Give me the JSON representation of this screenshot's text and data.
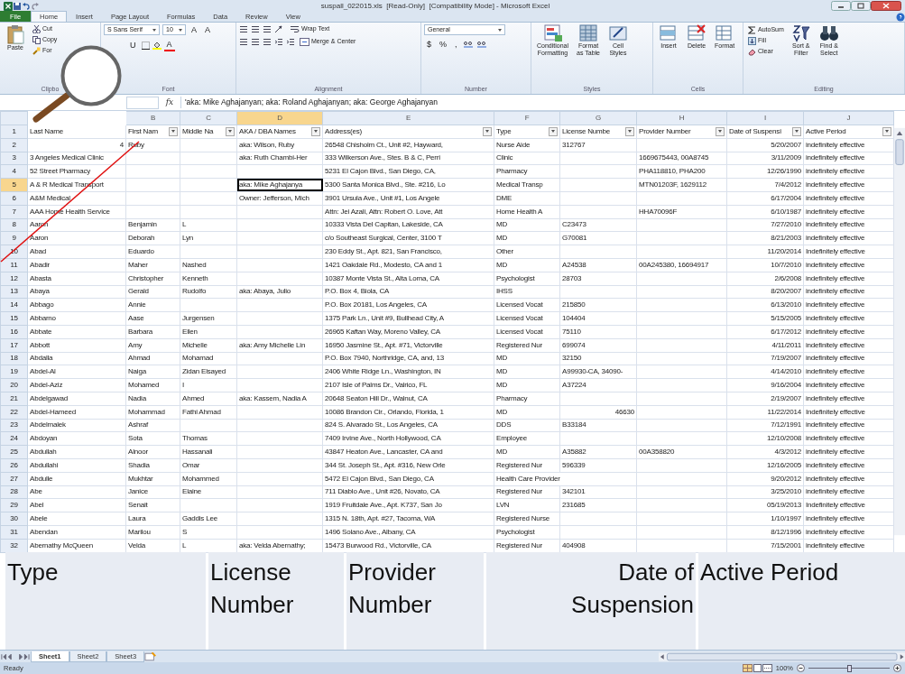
{
  "window": {
    "title": "suspall_022015.xls  [Read-Only]  [Compatibility Mode] - Microsoft Excel"
  },
  "ribbon_tabs": [
    {
      "label": "File",
      "kind": "file",
      "selected": false
    },
    {
      "label": "Home",
      "kind": "tab",
      "selected": true
    },
    {
      "label": "Insert",
      "kind": "tab",
      "selected": false
    },
    {
      "label": "Page Layout",
      "kind": "tab",
      "selected": false
    },
    {
      "label": "Formulas",
      "kind": "tab",
      "selected": false
    },
    {
      "label": "Data",
      "kind": "tab",
      "selected": false
    },
    {
      "label": "Review",
      "kind": "tab",
      "selected": false
    },
    {
      "label": "View",
      "kind": "tab",
      "selected": false
    }
  ],
  "ribbon_groups": [
    {
      "label": "Clipbo",
      "controls": [
        {
          "kind": "large",
          "lines": [
            "Paste"
          ]
        },
        {
          "kind": "stack",
          "items": [
            "Cut",
            "Copy",
            "For"
          ]
        }
      ]
    },
    {
      "label": "Font",
      "controls": [
        {
          "kind": "field",
          "text": "S Sans Serif"
        },
        {
          "kind": "field",
          "text": "10"
        },
        {
          "kind": "glyph",
          "text": "A"
        },
        {
          "kind": "glyph",
          "text": "A"
        },
        {
          "kind": "glyph",
          "text": "U"
        },
        {
          "kind": "icon"
        },
        {
          "kind": "icon"
        },
        {
          "kind": "glyph",
          "text": "A"
        }
      ]
    },
    {
      "label": "Alignment",
      "controls": [
        {
          "kind": "icon"
        },
        {
          "kind": "icon"
        },
        {
          "kind": "icon"
        },
        {
          "kind": "icon"
        },
        {
          "kind": "small",
          "text": "Wrap Text"
        },
        {
          "kind": "icon"
        },
        {
          "kind": "icon"
        },
        {
          "kind": "icon"
        },
        {
          "kind": "icon"
        },
        {
          "kind": "icon"
        },
        {
          "kind": "small",
          "text": "Merge & Center"
        }
      ]
    },
    {
      "label": "Number",
      "controls": [
        {
          "kind": "field",
          "text": "General"
        },
        {
          "kind": "glyph",
          "text": "$"
        },
        {
          "kind": "glyph",
          "text": "%"
        },
        {
          "kind": "glyph",
          "text": ","
        },
        {
          "kind": "icon"
        },
        {
          "kind": "icon"
        }
      ]
    },
    {
      "label": "Styles",
      "controls": [
        {
          "kind": "large",
          "lines": [
            "Conditional",
            "Formatting"
          ]
        },
        {
          "kind": "large",
          "lines": [
            "Format",
            "as Table"
          ]
        },
        {
          "kind": "large",
          "lines": [
            "Cell",
            "Styles"
          ]
        }
      ]
    },
    {
      "label": "Cells",
      "controls": [
        {
          "kind": "large",
          "lines": [
            "Insert"
          ]
        },
        {
          "kind": "large",
          "lines": [
            "Delete"
          ]
        },
        {
          "kind": "large",
          "lines": [
            "Format"
          ]
        }
      ]
    },
    {
      "label": "Editing",
      "controls": [
        {
          "kind": "stack",
          "items": [
            "AutoSum",
            "Fill",
            "Clear"
          ]
        },
        {
          "kind": "large",
          "lines": [
            "Sort &",
            "Filter"
          ]
        },
        {
          "kind": "large",
          "lines": [
            "Find &",
            "Select"
          ]
        }
      ]
    }
  ],
  "formula_bar": {
    "function_label": "fx",
    "value": "'aka: Mike Aghajanyan; aka: Roland Aghajanyan; aka: George Aghajanyan"
  },
  "columns": [
    {
      "letter": "B",
      "selected": false
    },
    {
      "letter": "C",
      "selected": false
    },
    {
      "letter": "D",
      "selected": true
    },
    {
      "letter": "E",
      "selected": false
    },
    {
      "letter": "F",
      "selected": false
    },
    {
      "letter": "G",
      "selected": false
    },
    {
      "letter": "H",
      "selected": false
    },
    {
      "letter": "I",
      "selected": false
    },
    {
      "letter": "J",
      "selected": false
    }
  ],
  "rows": [
    {
      "number": "1",
      "selected": false,
      "cells": [
        "Last Name",
        {
          "text": "First Nam",
          "filter": true
        },
        {
          "text": "Middle Na",
          "filter": true
        },
        {
          "text": "AKA / DBA Names",
          "filter": true
        },
        {
          "text": "Address(es)",
          "filter": true
        },
        {
          "text": "Type",
          "filter": true
        },
        {
          "text": "License Numbe",
          "filter": true
        },
        {
          "text": "Provider Number",
          "filter": true
        },
        {
          "text": "Date of Suspensi",
          "filter": true
        },
        {
          "text": "Active Period",
          "filter": true
        }
      ]
    },
    {
      "number": "2",
      "selected": false,
      "cells": [
        {
          "text": "4",
          "numeric": true
        },
        "Ruby",
        null,
        "aka: Wilson, Ruby",
        "26548 Chisholm Ct., Unit #2, Hayward,",
        "Nurse Aide",
        "312767",
        null,
        "5/20/2007",
        "indefinitely effective"
      ]
    },
    {
      "number": "3",
      "selected": false,
      "cells": [
        "3 Angeles Medical Clinic",
        null,
        null,
        "aka: Ruth Chambi-Her",
        "333 Wilkerson Ave., Stes. B & C, Perri",
        "Clinic",
        null,
        "1669675443, 00A8745",
        "3/11/2009",
        "indefinitely effective"
      ]
    },
    {
      "number": "4",
      "selected": false,
      "cells": [
        "52 Street Pharmacy",
        null,
        null,
        null,
        "5231 El Cajon Blvd., San Diego, CA,",
        "Pharmacy",
        null,
        "PHA118810, PHA200",
        "12/26/1990",
        "indefinitely effective"
      ]
    },
    {
      "number": "5",
      "selected": true,
      "cells": [
        "A & R Medical Transport",
        null,
        null,
        "aka: Mike Aghajanya",
        "5300 Santa Monica Blvd., Ste. #216, Lo",
        "Medical Transp",
        null,
        "MTN01203F, 1629112",
        "7/4/2012",
        "indefinitely effective"
      ]
    },
    {
      "number": "6",
      "selected": false,
      "cells": [
        "A&M Medical",
        null,
        null,
        "Owner: Jefferson, Mich",
        "3901 Ursula Ave., Unit #1, Los Angele",
        "DME",
        null,
        null,
        "6/17/2004",
        "indefinitely effective"
      ]
    },
    {
      "number": "7",
      "selected": false,
      "cells": [
        "AAA Home Health Service",
        null,
        null,
        null,
        "Attn: Jei Azali, Attn: Robert O. Love, Att",
        "Home Health A",
        null,
        "HHA70096F",
        "6/10/1987",
        "indefinitely effective"
      ]
    },
    {
      "number": "8",
      "selected": false,
      "cells": [
        "Aaron",
        "Benjamin",
        "L",
        null,
        "10333 Vista Del Capitan, Lakeside, CA",
        "MD",
        "C23473",
        null,
        "7/27/2010",
        "indefinitely effective"
      ]
    },
    {
      "number": "9",
      "selected": false,
      "cells": [
        "Aaron",
        "Deborah",
        "Lyn",
        null,
        "c/o Southeast Surgical, Center, 3100 T",
        "MD",
        "G70081",
        null,
        "8/21/2003",
        "indefinitely effective"
      ]
    },
    {
      "number": "10",
      "selected": false,
      "cells": [
        "Abad",
        "Eduardo",
        null,
        null,
        "230 Eddy St., Apt. 821, San Francisco,",
        "Other",
        null,
        null,
        "11/20/2014",
        "Indefinitely effective"
      ]
    },
    {
      "number": "11",
      "selected": false,
      "cells": [
        "Abadir",
        "Maher",
        "Nashed",
        null,
        "1421 Oakdale Rd., Modesto, CA and 1",
        "MD",
        "A24538",
        "00A245380, 16694917",
        "10/7/2010",
        "indefinitely effective"
      ]
    },
    {
      "number": "12",
      "selected": false,
      "cells": [
        "Abasta",
        "Christopher",
        "Kenneth",
        null,
        "10387 Monte Vista St., Alta Loma, CA",
        "Psychologist",
        "28703",
        null,
        "2/6/2008",
        "indefinitely effective"
      ]
    },
    {
      "number": "13",
      "selected": false,
      "cells": [
        "Abaya",
        "Gerald",
        "Rudolfo",
        "aka: Abaya, Julio",
        "P.O. Box 4, Biola, CA",
        "IHSS",
        null,
        null,
        "8/20/2007",
        "indefinitely effective"
      ]
    },
    {
      "number": "14",
      "selected": false,
      "cells": [
        "Abbago",
        "Annie",
        null,
        null,
        "P.O. Box 20181, Los Angeles, CA",
        "Licensed Vocat",
        "215850",
        null,
        "6/13/2010",
        "indefinitely effective"
      ]
    },
    {
      "number": "15",
      "selected": false,
      "cells": [
        "Abbarno",
        "Aase",
        "Jurgensen",
        null,
        "1375 Park Ln., Unit #9, Bullhead City, A",
        "Licensed Vocat",
        "104404",
        null,
        "5/15/2005",
        "indefinitely effective"
      ]
    },
    {
      "number": "16",
      "selected": false,
      "cells": [
        "Abbate",
        "Barbara",
        "Ellen",
        null,
        "26965 Kaftan Way, Moreno Valley, CA",
        "Licensed Vocat",
        "75110",
        null,
        "6/17/2012",
        "indefinitely effective"
      ]
    },
    {
      "number": "17",
      "selected": false,
      "cells": [
        "Abbott",
        "Amy",
        "Michelle",
        "aka: Amy Michelle Lin",
        "16950 Jasmine St., Apt. #71, Victorville",
        "Registered Nur",
        "699074",
        null,
        "4/11/2011",
        "indefinitely effective"
      ]
    },
    {
      "number": "18",
      "selected": false,
      "cells": [
        "Abdalla",
        "Ahmad",
        "Mohamad",
        null,
        "P.O. Box 7940, Northridge, CA, and, 13",
        "MD",
        "32150",
        null,
        "7/19/2007",
        "indefinitely effective"
      ]
    },
    {
      "number": "19",
      "selected": false,
      "cells": [
        "Abdel-Al",
        "Naiga",
        "Zidan Elsayed",
        null,
        "2406 White Ridge Ln., Washington, IN",
        "MD",
        "A99930-CA, 34090-",
        null,
        "4/14/2010",
        "indefinitely effective"
      ]
    },
    {
      "number": "20",
      "selected": false,
      "cells": [
        "Abdel-Aziz",
        "Mohamed",
        "I",
        null,
        "2107 Isle of Palms Dr., Valrico, FL",
        "MD",
        "A37224",
        null,
        "9/16/2004",
        "indefinitely effective"
      ]
    },
    {
      "number": "21",
      "selected": false,
      "cells": [
        "Abdelgawad",
        "Nadia",
        "Ahmed",
        "aka: Kassem, Nadia A",
        "20648 Seaton Hill Dr., Walnut, CA",
        "Pharmacy",
        null,
        null,
        "2/19/2007",
        "indefinitely effective"
      ]
    },
    {
      "number": "22",
      "selected": false,
      "cells": [
        "Abdel-Hameed",
        "Mohammad",
        "Fathi Ahmad",
        null,
        "10086 Brandon Cir., Orlando, Florida, 1",
        "MD",
        {
          "text": "46630",
          "numeric": true
        },
        null,
        "11/22/2014",
        "Indefinitely effective"
      ]
    },
    {
      "number": "23",
      "selected": false,
      "cells": [
        "Abdelmalek",
        "Ashraf",
        null,
        null,
        "824 S. Alvarado St., Los Angeles, CA",
        "DDS",
        "B33184",
        null,
        "7/12/1991",
        "indefinitely effective"
      ]
    },
    {
      "number": "24",
      "selected": false,
      "cells": [
        "Abdoyan",
        "Sota",
        "Thomas",
        null,
        "7409 Irvine Ave., North Hollywood, CA",
        "Employee",
        null,
        null,
        "12/10/2008",
        "indefinitely effective"
      ]
    },
    {
      "number": "25",
      "selected": false,
      "cells": [
        "Abdullah",
        "Alnoor",
        "Hassanali",
        null,
        "43847 Heaton Ave., Lancaster, CA and",
        "MD",
        "A35882",
        "00A358820",
        "4/3/2012",
        "indefinitely effective"
      ]
    },
    {
      "number": "26",
      "selected": false,
      "cells": [
        "Abdullahi",
        "Shadia",
        "Omar",
        null,
        "344 St. Joseph St., Apt. #316, New Orle",
        "Registered Nur",
        "596339",
        null,
        "12/16/2005",
        "indefinitely effective"
      ]
    },
    {
      "number": "27",
      "selected": false,
      "cells": [
        "Abdulle",
        "Mukhtar",
        "Mohammed",
        null,
        "5472 El Cajon Blvd., San Diego, CA",
        "Health Care Provider",
        null,
        null,
        "9/20/2012",
        "indefinitely effective"
      ]
    },
    {
      "number": "28",
      "selected": false,
      "cells": [
        "Abe",
        "Janice",
        "Elaine",
        null,
        "711 Diablo Ave., Unit #26, Novato, CA",
        "Registered Nur",
        "342101",
        null,
        "3/25/2010",
        "indefinitely effective"
      ]
    },
    {
      "number": "29",
      "selected": false,
      "cells": [
        "Abel",
        "Senait",
        null,
        null,
        "1919 Fruitdale Ave., Apt. K737, San Jo",
        "LVN",
        "231685",
        null,
        "05/19/2013",
        "Indefinitely effective"
      ]
    },
    {
      "number": "30",
      "selected": false,
      "cells": [
        "Abele",
        "Laura",
        "Gaddis Lee",
        null,
        "1315 N. 18th, Apt. #27, Tacoma, WA",
        "Registered Nurse",
        null,
        null,
        "1/10/1997",
        "indefinitely effective"
      ]
    },
    {
      "number": "31",
      "selected": false,
      "cells": [
        "Abendan",
        "Marilou",
        "S",
        null,
        "1496 Solano Ave., Albany, CA",
        "Psychologist",
        null,
        null,
        "8/12/1996",
        "indefinitely effective"
      ]
    },
    {
      "number": "32",
      "selected": false,
      "cells": [
        "Abernathy McQueen",
        "Velda",
        "L",
        "aka: Velda Abernathy;",
        "15473 Burwood Rd., Victorville, CA",
        "Registered Nur",
        "404908",
        null,
        "7/15/2001",
        "indefinitely effective"
      ]
    }
  ],
  "zoom_strip": [
    {
      "lines": [
        "Type"
      ]
    },
    {
      "lines": [
        "License",
        "Number"
      ]
    },
    {
      "lines": [
        "Provider",
        "Number"
      ]
    },
    {
      "lines": [
        "Date of",
        "Suspension"
      ]
    },
    {
      "lines": [
        "Active Period"
      ]
    }
  ],
  "sheet_tabs": [
    {
      "label": "Sheet1",
      "selected": true
    },
    {
      "label": "Sheet2",
      "selected": false
    },
    {
      "label": "Sheet3",
      "selected": false
    }
  ],
  "status_bar": {
    "text": "Ready",
    "zoom": "100%",
    "zoom_slider": {
      "level": 0.5
    }
  }
}
